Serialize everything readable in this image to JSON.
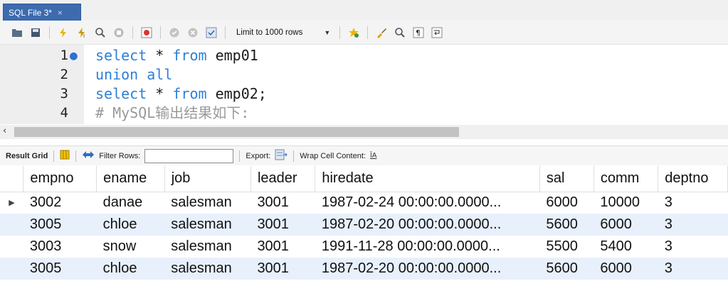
{
  "tab": {
    "label": "SQL File 3*",
    "close": "×"
  },
  "toolbar": {
    "limit_label": "Limit to 1000 rows",
    "icons": [
      "open-folder-icon",
      "save-icon",
      "execute-icon",
      "execute-current-icon",
      "explain-icon",
      "stop-icon",
      "toggle-continue-icon",
      "commit-icon",
      "rollback-icon",
      "autocommit-icon",
      "beautify-icon",
      "find-icon",
      "invisible-chars-icon",
      "wrap-icon"
    ]
  },
  "editor": {
    "lines": [
      {
        "num": "1",
        "marker": "●",
        "parts": [
          [
            "kw",
            "select"
          ],
          [
            "tx",
            " * "
          ],
          [
            "kw",
            "from"
          ],
          [
            "tx",
            " emp01"
          ]
        ]
      },
      {
        "num": "2",
        "marker": "",
        "parts": [
          [
            "kw",
            "union all"
          ]
        ]
      },
      {
        "num": "3",
        "marker": "",
        "parts": [
          [
            "kw",
            "select"
          ],
          [
            "tx",
            " * "
          ],
          [
            "kw",
            "from"
          ],
          [
            "tx",
            " emp02;"
          ]
        ]
      },
      {
        "num": "4",
        "marker": "",
        "parts": [
          [
            "cm",
            "# MySQL输出结果如下:"
          ]
        ]
      }
    ]
  },
  "result_bar": {
    "result_grid": "Result Grid",
    "filter_rows": "Filter Rows:",
    "filter_value": "",
    "export": "Export:",
    "wrap": "Wrap Cell Content:",
    "wrap_icon_text": "ĪA"
  },
  "grid": {
    "columns": [
      "empno",
      "ename",
      "job",
      "leader",
      "hiredate",
      "sal",
      "comm",
      "deptno"
    ],
    "rows": [
      [
        "3002",
        "danae",
        "salesman",
        "3001",
        "1987-02-24 00:00:00.0000...",
        "6000",
        "10000",
        "3"
      ],
      [
        "3005",
        "chloe",
        "salesman",
        "3001",
        "1987-02-20 00:00:00.0000...",
        "5600",
        "6000",
        "3"
      ],
      [
        "3003",
        "snow",
        "salesman",
        "3001",
        "1991-11-28 00:00:00.0000...",
        "5500",
        "5400",
        "3"
      ],
      [
        "3005",
        "chloe",
        "salesman",
        "3001",
        "1987-02-20 00:00:00.0000...",
        "5600",
        "6000",
        "3"
      ]
    ],
    "current_row_marker": "▶"
  },
  "colors": {
    "tab": "#3d6bae",
    "keyword": "#2c7fd8",
    "comment": "#9a9a9a",
    "alt_row": "#e8f0fb"
  }
}
